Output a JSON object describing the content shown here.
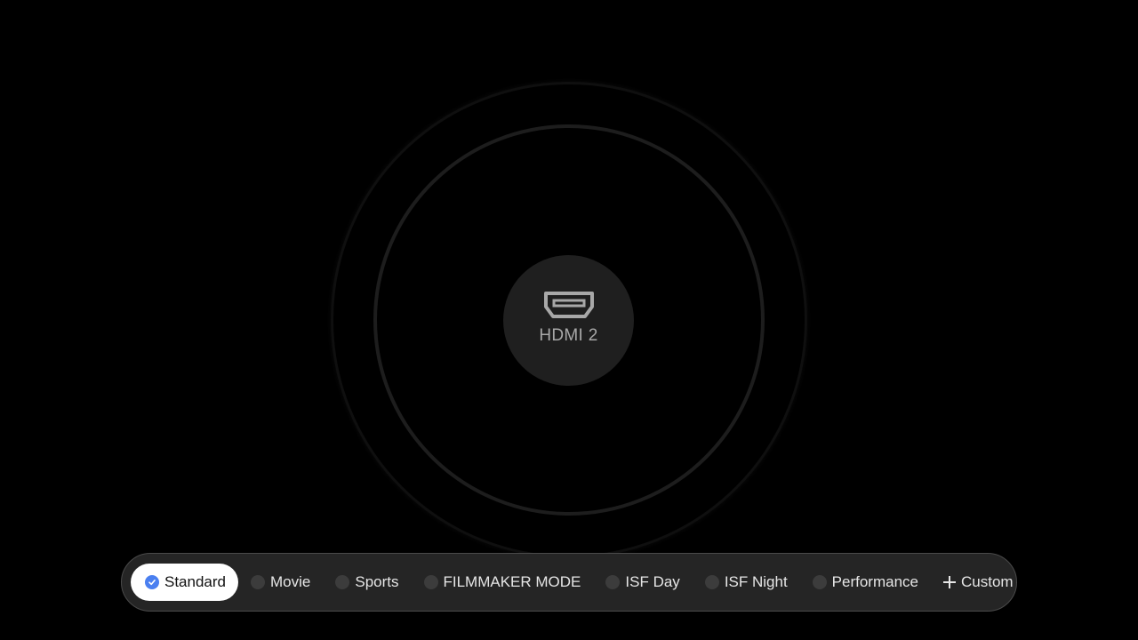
{
  "source": {
    "label": "HDMI 2",
    "icon": "hdmi-port-icon"
  },
  "picture_modes": {
    "selected_index": 0,
    "accent_color": "#4a7ff0",
    "items": [
      {
        "label": "Standard",
        "selected": true
      },
      {
        "label": "Movie",
        "selected": false
      },
      {
        "label": "Sports",
        "selected": false
      },
      {
        "label": "FILMMAKER MODE",
        "selected": false
      },
      {
        "label": "ISF Day",
        "selected": false
      },
      {
        "label": "ISF Night",
        "selected": false
      },
      {
        "label": "Performance",
        "selected": false
      }
    ],
    "custom": {
      "label": "Custom",
      "icon": "plus-icon"
    }
  }
}
